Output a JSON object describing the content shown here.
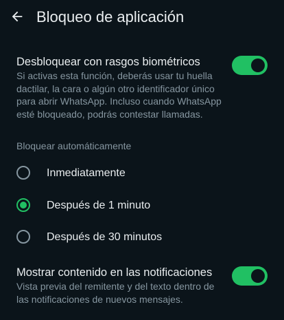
{
  "app_bar": {
    "back_icon": "arrow-back-icon",
    "title": "Bloqueo de aplicación"
  },
  "biometric": {
    "title": "Desbloquear con rasgos biométricos",
    "description": "Si activas esta función, deberás usar tu huella dactilar, la cara o algún otro identificador único para abrir WhatsApp. Incluso cuando WhatsApp esté bloqueado, podrás contestar llamadas.",
    "enabled": true
  },
  "auto_lock": {
    "label": "Bloquear automáticamente",
    "selected": "Después de 1 minuto",
    "options": [
      {
        "label": "Inmediatamente",
        "checked": false
      },
      {
        "label": "Después de 1 minuto",
        "checked": true
      },
      {
        "label": "Después de 30 minutos",
        "checked": false
      }
    ]
  },
  "notifications": {
    "title": "Mostrar contenido en las notificaciones",
    "description": "Vista previa del remitente y del texto dentro de las notificaciones de nuevos mensajes.",
    "enabled": true
  },
  "colors": {
    "background": "#0b141a",
    "accent": "#21c063",
    "primary_text": "#e9edef",
    "secondary_text": "#8696a0"
  }
}
